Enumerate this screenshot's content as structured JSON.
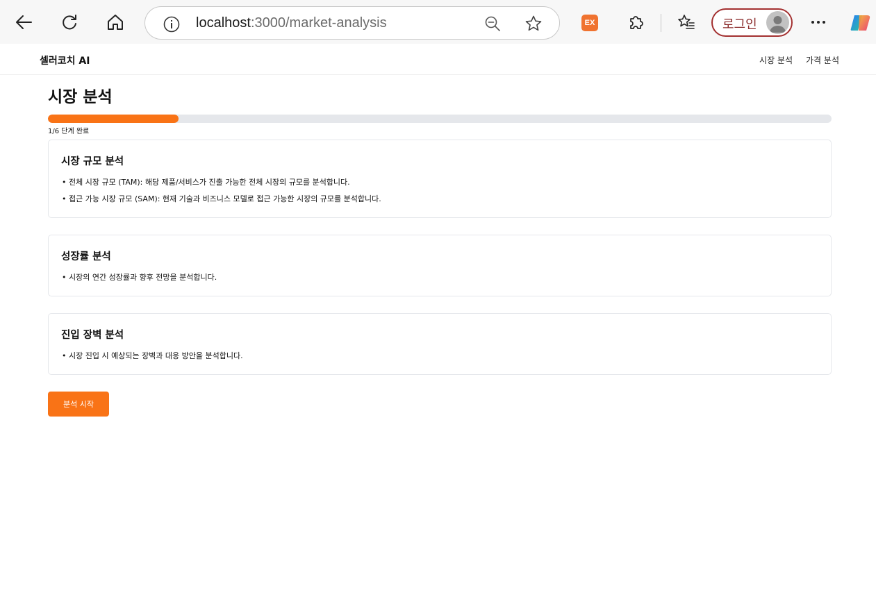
{
  "browser": {
    "url_host": "localhost",
    "url_path": ":3000/market-analysis",
    "ext_badge": "EX",
    "login_label": "로그인"
  },
  "nav": {
    "brand": "셀러코치 AI",
    "links": [
      "시장 분석",
      "가격 분석"
    ]
  },
  "main": {
    "title": "시장 분석",
    "progress": {
      "fraction": 0.1667,
      "label": "1/6 단계 완료"
    },
    "sections": [
      {
        "title": "시장 규모 분석",
        "items": [
          "전체 시장 규모 (TAM): 해당 제품/서비스가 진출 가능한 전체 시장의 규모를 분석합니다.",
          "접근 가능 시장 규모 (SAM): 현재 기술과 비즈니스 모델로 접근 가능한 시장의 규모를 분석합니다."
        ]
      },
      {
        "title": "성장률 분석",
        "items": [
          "시장의 연간 성장률과 향후 전망을 분석합니다."
        ]
      },
      {
        "title": "진입 장벽 분석",
        "items": [
          "시장 진입 시 예상되는 장벽과 대응 방안을 분석합니다."
        ]
      }
    ],
    "start_button": "분석 시작"
  },
  "colors": {
    "accent": "#f97316",
    "track": "#e5e7eb"
  }
}
